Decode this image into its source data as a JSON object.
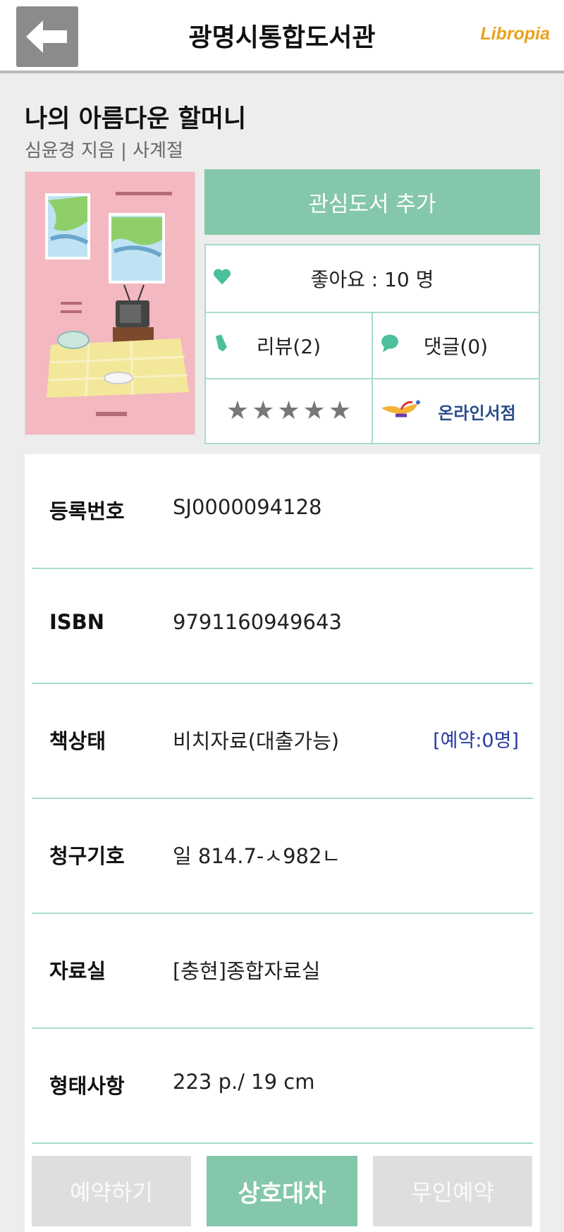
{
  "header": {
    "back_icon": "arrow-left-icon",
    "title": "광명시통합도서관",
    "brand": "Libropia"
  },
  "book": {
    "title": "나의 아름다운 할머니",
    "meta": "심윤경 지음 | 사계절"
  },
  "actions": {
    "add_favorite": "관심도서 추가",
    "likes": "좋아요 : 10 명",
    "reviews": "리뷰(2)",
    "comments": "댓글(0)",
    "rating_stars": 0,
    "online_store": "온라인서점"
  },
  "details": [
    {
      "label": "등록번호",
      "value": "SJ0000094128"
    },
    {
      "label": "ISBN",
      "value": "9791160949643"
    },
    {
      "label": "책상태",
      "value": "비치자료(대출가능)",
      "extra": "[예약:0명]"
    },
    {
      "label": "청구기호",
      "value": "일 814.7-ㅅ982ㄴ"
    },
    {
      "label": "자료실",
      "value": "[충현]종합자료실"
    },
    {
      "label": "형태사항",
      "value": "223 p./ 19 cm"
    }
  ],
  "buttons": {
    "reserve": "예약하기",
    "interlibrary": "상호대차",
    "unmanned": "무인예약"
  },
  "colors": {
    "accent": "#84c7aa",
    "border": "#a7dcc6",
    "brand": "#e8a21c",
    "link": "#2a3aa0"
  }
}
